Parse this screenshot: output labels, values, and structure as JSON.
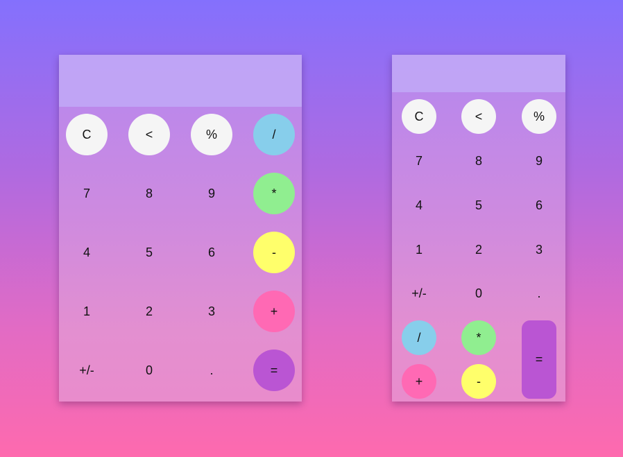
{
  "colors": {
    "light_key": "#f5f5f5",
    "divide_key": "#87ceeb",
    "multiply_key": "#90ee90",
    "subtract_key": "#ffff6b",
    "add_key": "#ff69b4",
    "equals_key": "#ba55d3"
  },
  "calc1": {
    "display": "",
    "keys": {
      "clear": "C",
      "back": "<",
      "percent": "%",
      "divide": "/",
      "seven": "7",
      "eight": "8",
      "nine": "9",
      "multiply": "*",
      "four": "4",
      "five": "5",
      "six": "6",
      "subtract": "-",
      "one": "1",
      "two": "2",
      "three": "3",
      "add": "+",
      "negate": "+/-",
      "zero": "0",
      "decimal": ".",
      "equals": "="
    }
  },
  "calc2": {
    "display": "",
    "keys": {
      "clear": "C",
      "back": "<",
      "percent": "%",
      "seven": "7",
      "eight": "8",
      "nine": "9",
      "four": "4",
      "five": "5",
      "six": "6",
      "one": "1",
      "two": "2",
      "three": "3",
      "negate": "+/-",
      "zero": "0",
      "decimal": ".",
      "divide": "/",
      "multiply": "*",
      "equals": "=",
      "add": "+",
      "subtract": "-"
    }
  }
}
